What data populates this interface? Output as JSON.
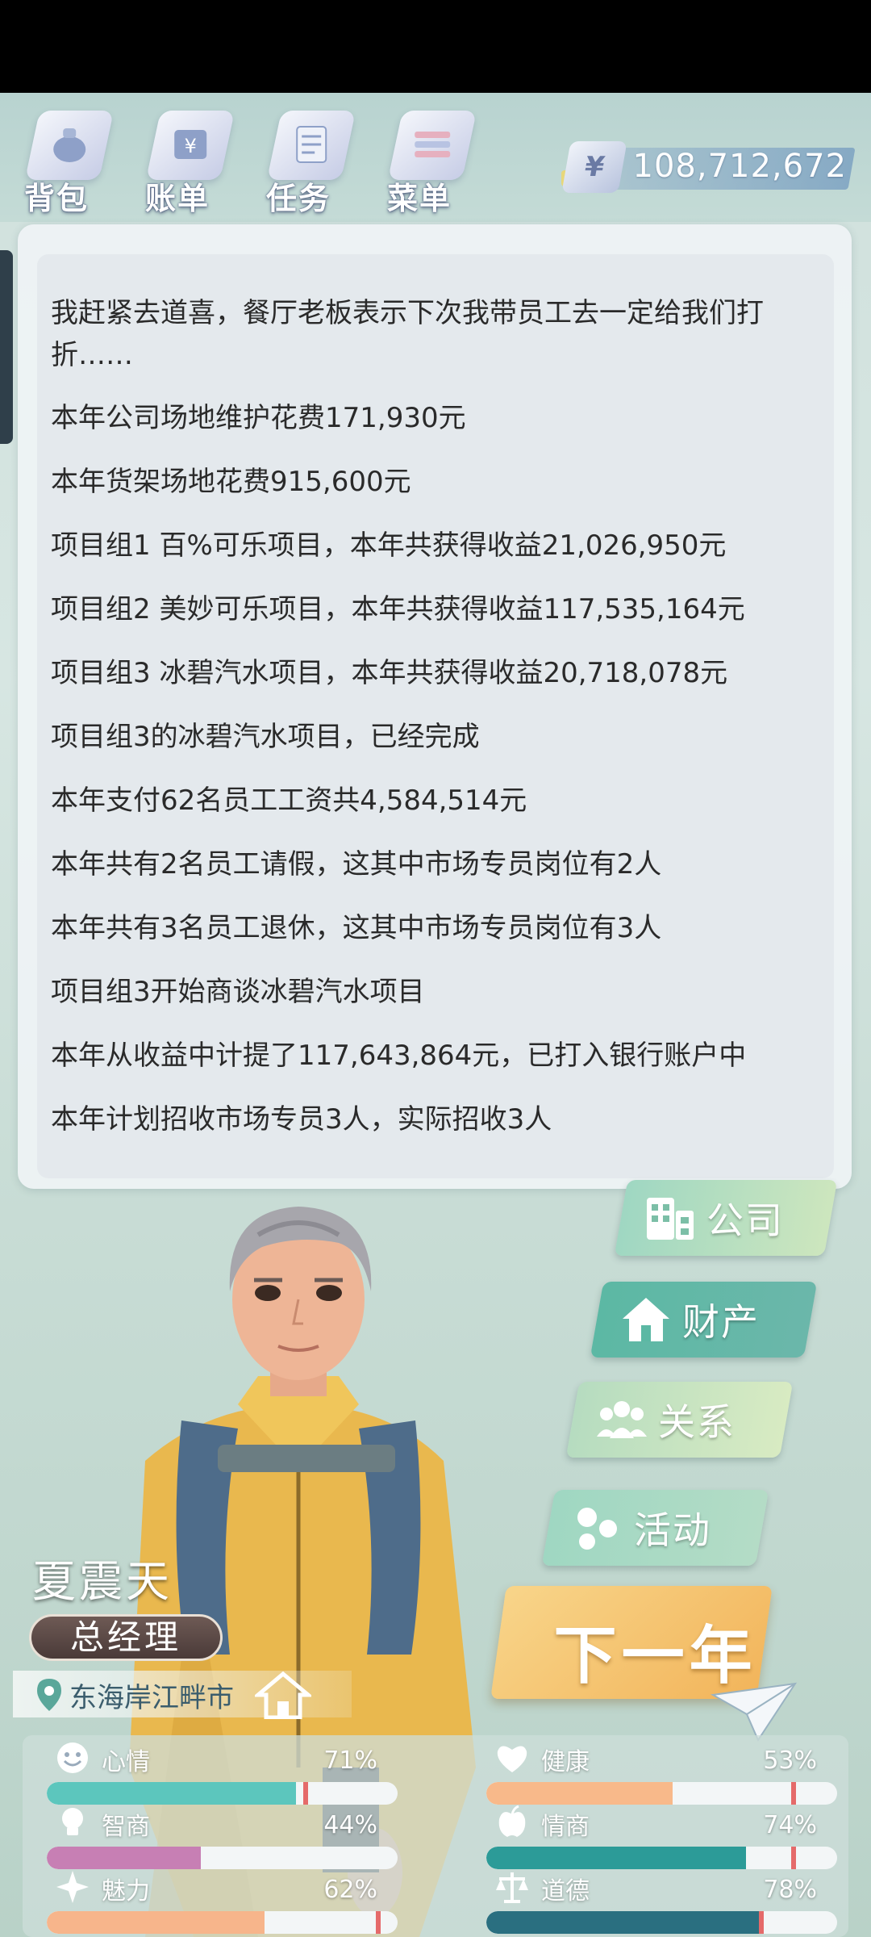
{
  "toolbar": {
    "backpack_label": "背包",
    "bills_label": "账单",
    "tasks_label": "任务",
    "menu_label": "菜单"
  },
  "currency": {
    "symbol": "¥",
    "amount": "108,712,672"
  },
  "log": {
    "lines": [
      "我赶紧去道喜，餐厅老板表示下次我带员工去一定给我们打",
      "折……",
      "本年公司场地维护花费171,930元",
      "本年货架场地花费915,600元",
      "项目组1 百%可乐项目，本年共获得收益21,026,950元",
      "项目组2 美妙可乐项目，本年共获得收益117,535,164元",
      "项目组3 冰碧汽水项目，本年共获得收益20,718,078元",
      "项目组3的冰碧汽水项目，已经完成",
      "本年支付62名员工工资共4,584,514元",
      "本年共有2名员工请假，这其中市场专员岗位有2人",
      "本年共有3名员工退休，这其中市场专员岗位有3人",
      "项目组3开始商谈冰碧汽水项目",
      "本年从收益中计提了117,643,864元，已打入银行账户中",
      "本年计划招收市场专员3人，实际招收3人"
    ]
  },
  "menu": {
    "company": "公司",
    "property": "财产",
    "relations": "关系",
    "activity": "活动",
    "next_year": "下一年"
  },
  "character": {
    "name": "夏震天",
    "title": "总经理",
    "location": "东海岸江畔市"
  },
  "stats": {
    "mood": {
      "label": "心情",
      "value": "71%",
      "level": 0.71,
      "color": "#5cc6bd"
    },
    "health": {
      "label": "健康",
      "value": "53%",
      "level": 0.53,
      "color": "#f8b98a"
    },
    "iq": {
      "label": "智商",
      "value": "44%",
      "level": 0.44,
      "color": "#c77fb4"
    },
    "eq": {
      "label": "情商",
      "value": "74%",
      "level": 0.74,
      "color": "#2c9b98"
    },
    "charm": {
      "label": "魅力",
      "value": "62%",
      "level": 0.62,
      "color": "#f7b58b"
    },
    "morality": {
      "label": "道德",
      "value": "78%",
      "level": 0.78,
      "color": "#2a6f80"
    }
  }
}
